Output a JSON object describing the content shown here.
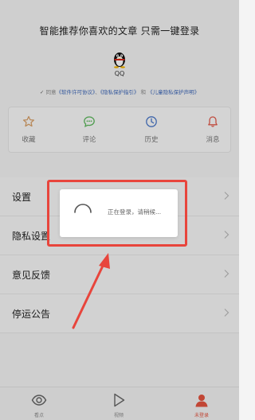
{
  "header": {
    "title": "智能推荐你喜欢的文章 只需一键登录"
  },
  "login": {
    "qq_label": "QQ"
  },
  "agreement": {
    "check": "✓",
    "prefix": "同意",
    "link1": "《软件许可协议》",
    "sep1": "、",
    "link2": "《隐私保护指引》",
    "and": "和",
    "link3": "《儿童隐私保护声明》"
  },
  "shortcuts": [
    {
      "label": "收藏",
      "icon": "star-icon"
    },
    {
      "label": "评论",
      "icon": "comment-icon"
    },
    {
      "label": "历史",
      "icon": "clock-icon"
    },
    {
      "label": "消息",
      "icon": "bell-icon"
    }
  ],
  "menu": [
    {
      "label": "设置"
    },
    {
      "label": "隐私设置"
    },
    {
      "label": "意见反馈"
    },
    {
      "label": "停运公告"
    }
  ],
  "dialog": {
    "message": "正在登录，请稍候..."
  },
  "tabs": [
    {
      "label": "看点",
      "icon": "eye-icon",
      "active": false
    },
    {
      "label": "视频",
      "icon": "play-icon",
      "active": false
    },
    {
      "label": "未登录",
      "icon": "user-icon",
      "active": true
    }
  ],
  "colors": {
    "accent": "#e3533f",
    "link": "#3d67b8",
    "highlight": "#e8453c",
    "star": "#d9a16a",
    "comment": "#5cb85c",
    "clock": "#4a78c8",
    "bell": "#e25b4c"
  }
}
